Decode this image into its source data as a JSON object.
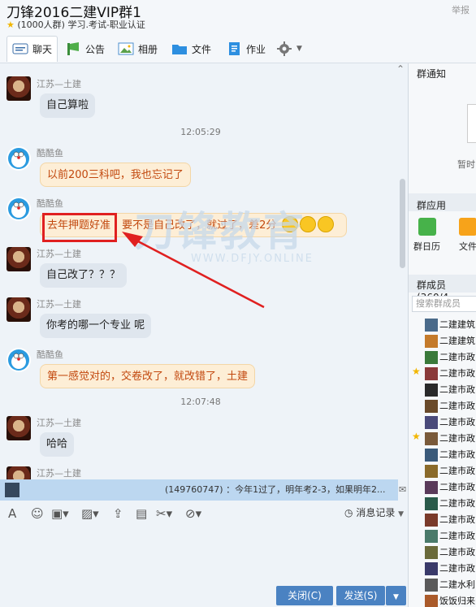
{
  "header": {
    "title": "刀锋2016二建VIP群1",
    "report": "举报",
    "star": "★",
    "subtitle": "(1000人群) 学习.考试-职业认证"
  },
  "tabs": [
    "聊天",
    "公告",
    "相册",
    "文件",
    "作业"
  ],
  "messages": [
    {
      "name": "江苏—土建",
      "text": "自己算啦"
    },
    {
      "time": "12:05:29"
    },
    {
      "name": "酷酷鱼",
      "text": "以前200三科吧，我也忘记了"
    },
    {
      "name": "酷酷鱼",
      "text_a": "去年押题好准",
      "text_b": "要不是自己改了，就过了，差2分"
    },
    {
      "name": "江苏—土建",
      "text": "自己改了？？？"
    },
    {
      "name": "江苏—土建",
      "text": "你考的哪一个专业 呢"
    },
    {
      "name": "酷酷鱼",
      "text": "第一感觉对的，交卷改了，就改错了，土建"
    },
    {
      "time": "12:07:48"
    },
    {
      "name": "江苏—土建",
      "text": "哈哈"
    },
    {
      "name": "江苏—土建"
    }
  ],
  "watermark": {
    "cn": "刀锋教育",
    "en": "WWW.DFJY.ONLINE",
    "reg": "®"
  },
  "notice_bar": {
    "text": "(149760747) ：今年1过了，明年考2-3，如果明年2..."
  },
  "toolbar": {
    "history_label": "消息记录"
  },
  "buttons": {
    "close": "关闭(C)",
    "send": "发送(S)"
  },
  "right": {
    "notice_title": "群通知",
    "notice_hint": "暂时",
    "apps_title": "群应用",
    "apps": [
      "群日历",
      "文件"
    ],
    "members_title": "群成员(360/4",
    "search_placeholder": "搜索群成员",
    "members": [
      "二建建筑",
      "二建建筑",
      "二建市政",
      "二建市政",
      "二建市政",
      "二建市政",
      "二建市政",
      "二建市政",
      "二建市政",
      "二建市政",
      "二建市政",
      "二建市政",
      "二建市政",
      "二建市政",
      "二建市政",
      "二建市政",
      "二建水利",
      "饭饭归来"
    ]
  },
  "colors": {
    "accent": "#4a82c2",
    "bubble_orange": "#fdeed6",
    "bubble_gray": "#dfe6ee",
    "highlight": "#e02020"
  }
}
